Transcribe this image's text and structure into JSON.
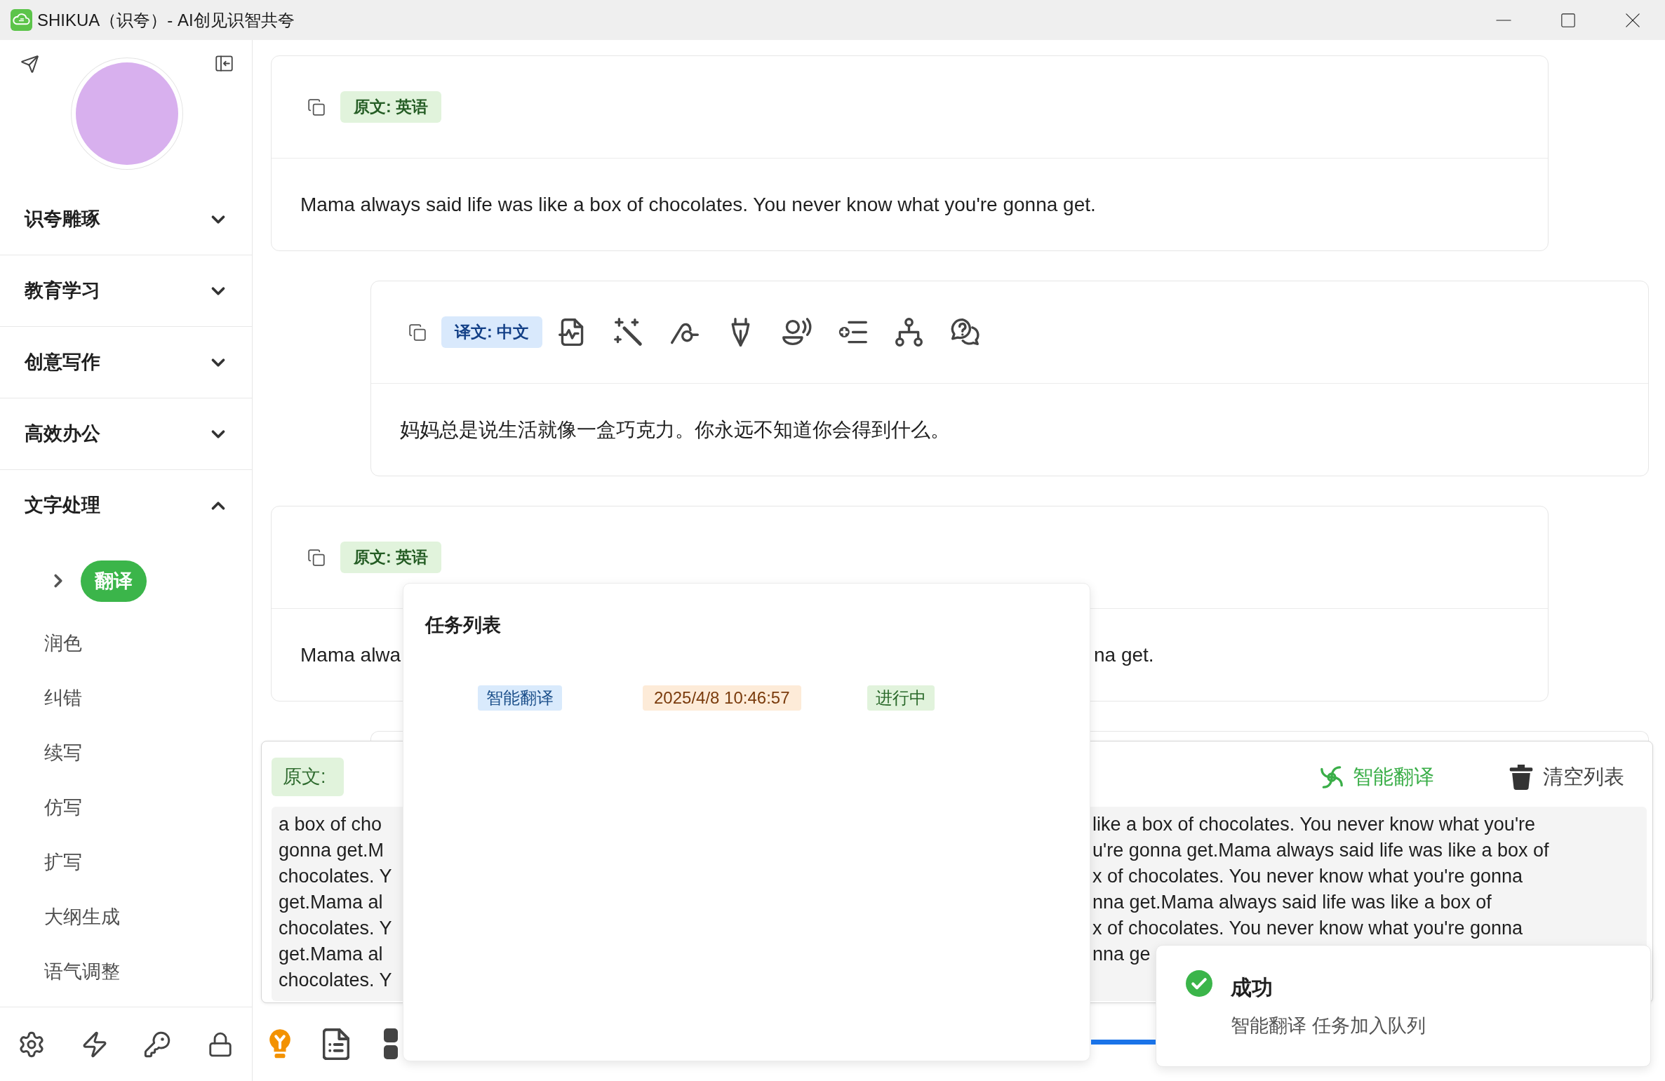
{
  "window": {
    "title": "SHIKUA（识夸）- AI创见识智共夸"
  },
  "sidebar": {
    "sections": [
      {
        "label": "识夸雕琢",
        "expanded": false
      },
      {
        "label": "教育学习",
        "expanded": false
      },
      {
        "label": "创意写作",
        "expanded": false
      },
      {
        "label": "高效办公",
        "expanded": false
      },
      {
        "label": "文字处理",
        "expanded": true,
        "items": [
          {
            "label": "翻译",
            "selected": true
          },
          {
            "label": "润色",
            "selected": false
          },
          {
            "label": "纠错",
            "selected": false
          },
          {
            "label": "续写",
            "selected": false
          },
          {
            "label": "仿写",
            "selected": false
          },
          {
            "label": "扩写",
            "selected": false
          },
          {
            "label": "大纲生成",
            "selected": false
          },
          {
            "label": "语气调整",
            "selected": false
          }
        ]
      }
    ]
  },
  "messages": [
    {
      "kind": "source",
      "badge": "原文: 英语",
      "text": "Mama always said life was like a box of chocolates. You never know what you're gonna get."
    },
    {
      "kind": "translation",
      "badge": "译文: 中文",
      "text": "妈妈总是说生活就像一盒巧克力。你永远不知道你会得到什么。"
    },
    {
      "kind": "source",
      "badge": "原文: 英语",
      "text_fragments": [
        "Mama alwa",
        "na get."
      ]
    },
    {
      "kind": "translation"
    }
  ],
  "input_panel": {
    "tab": "原文:",
    "actions": [
      {
        "kind": "translate",
        "label": "智能翻译"
      },
      {
        "kind": "clear",
        "label": "清空列表"
      }
    ],
    "lines": [
      {
        "start": "a box of cho",
        "end": "like a box of chocolates. You never know what you're"
      },
      {
        "start": "gonna get.M",
        "end": "u're gonna get.Mama always said life was like a box of"
      },
      {
        "start": "chocolates. Y",
        "end": "x of chocolates. You never know what you're gonna"
      },
      {
        "start": "get.Mama al",
        "end": "nna get.Mama always said life was like a box of"
      },
      {
        "start": "chocolates. Y",
        "end": "x of chocolates. You never know what you're gonna"
      },
      {
        "start": "get.Mama al",
        "end": "nna ge"
      },
      {
        "start": "chocolates. Y"
      }
    ]
  },
  "task_popup": {
    "title": "任务列表",
    "tasks": [
      {
        "name": "智能翻译",
        "time": "2025/4/8 10:46:57",
        "status": "进行中"
      }
    ]
  },
  "toast": {
    "kind": "success",
    "title": "成功",
    "message": "智能翻译 任务加入队列"
  }
}
